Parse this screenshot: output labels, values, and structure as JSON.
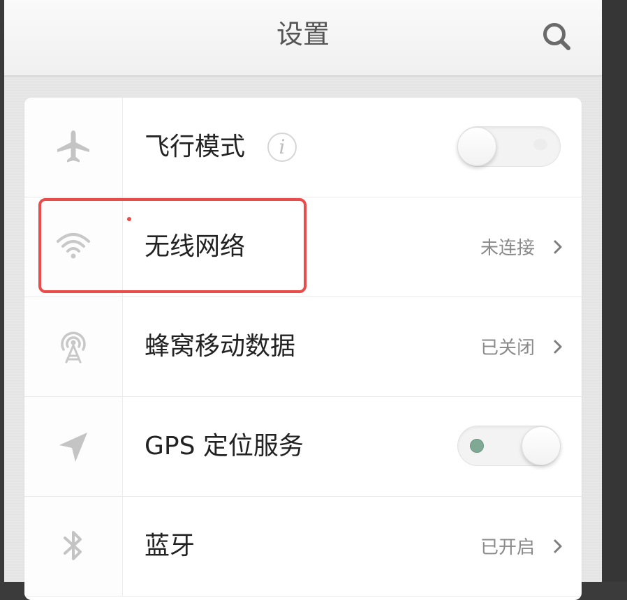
{
  "header": {
    "title": "设置",
    "search_icon": "search-icon"
  },
  "settings": [
    {
      "label": "飞行模式",
      "icon": "airplane-icon",
      "info_glyph": "i",
      "toggle": {
        "on": false
      }
    },
    {
      "label": "无线网络",
      "icon": "wifi-icon",
      "status": "未连接",
      "highlighted": true
    },
    {
      "label": "蜂窝移动数据",
      "icon": "cellular-tower-icon",
      "status": "已关闭"
    },
    {
      "label": "GPS 定位服务",
      "icon": "location-arrow-icon",
      "toggle": {
        "on": true
      }
    },
    {
      "label": "蓝牙",
      "icon": "bluetooth-icon",
      "status": "已开启"
    }
  ],
  "colors": {
    "highlight": "#ea4b4b",
    "toggle_on_dot": "#7fa895",
    "icon_gray": "#c4c4c4",
    "status_gray": "#8a8a8a"
  }
}
